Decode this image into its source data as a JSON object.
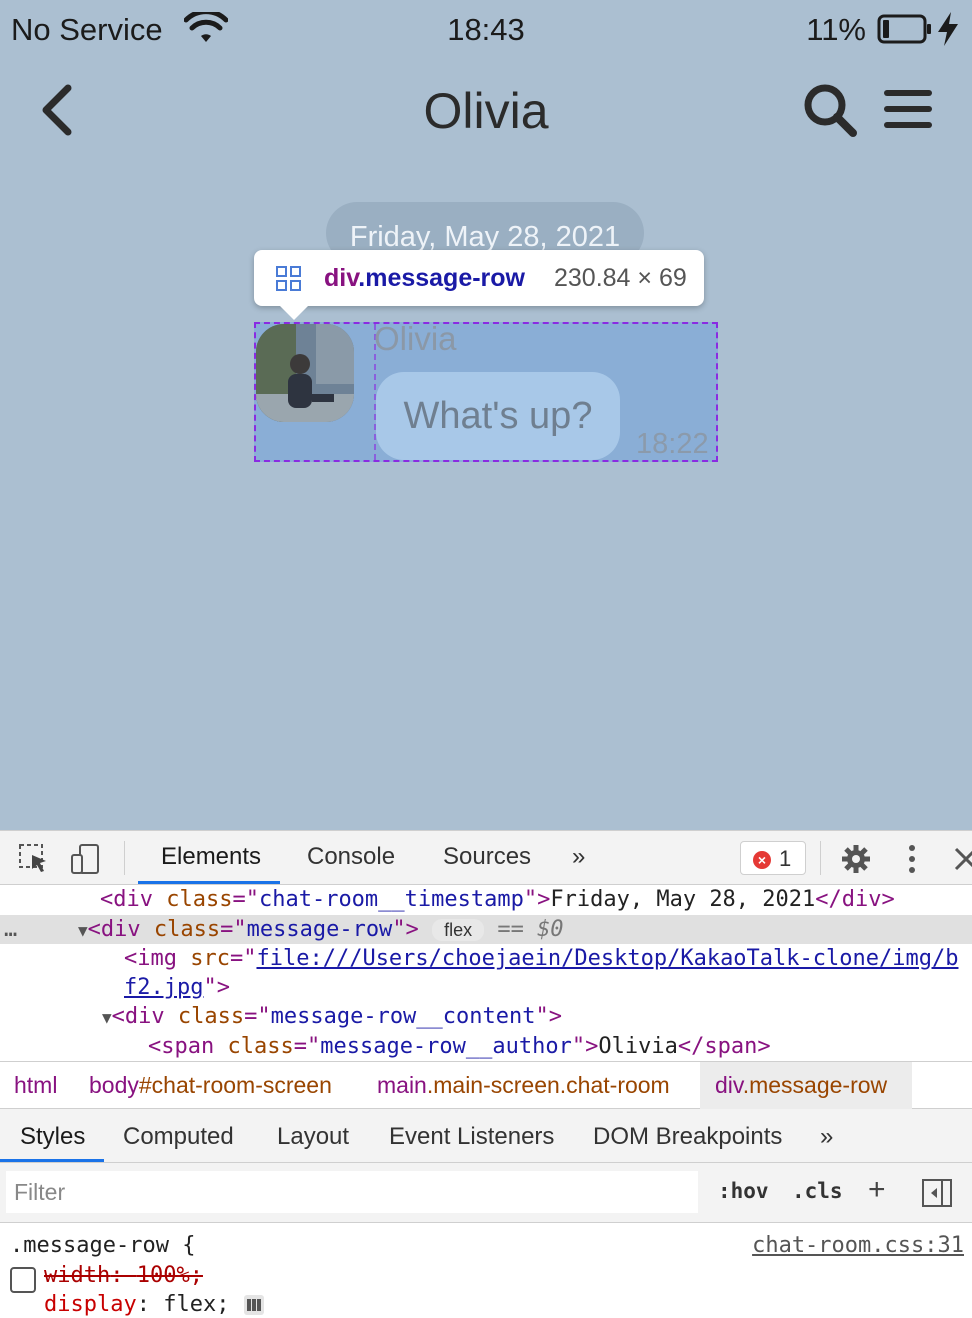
{
  "status_bar": {
    "carrier": "No Service",
    "time": "18:43",
    "battery": "11%"
  },
  "header": {
    "title": "Olivia"
  },
  "chat": {
    "date": "Friday, May 28, 2021",
    "author": "Olivia",
    "message": "What's up?",
    "time": "18:22"
  },
  "inspect_tooltip": {
    "tag": "div",
    "class_name": ".message-row",
    "dimensions": "230.84 × 69"
  },
  "devtools": {
    "tabs": [
      "Elements",
      "Console",
      "Sources",
      "»"
    ],
    "error_count": "1",
    "dom": {
      "line1": {
        "tag_open": "<div ",
        "attr": "class",
        "eq": "=\"",
        "val": "chat-room__timestamp",
        "close": "\">",
        "text": "Friday, May 28, 2021",
        "tag_close": "</div>"
      },
      "line2": {
        "ellipsis": "…",
        "tag_open": "<div ",
        "attr": "class",
        "eq": "=\"",
        "val": "message-row",
        "close": "\">",
        "badge": "flex",
        "ref": "== $0"
      },
      "line3": {
        "tag_open": "<img ",
        "attr": "src",
        "eq": "=\"",
        "val": "file:///Users/choejaein/Desktop/KakaoTalk-clone/img/b"
      },
      "line4": {
        "val": "f2.jpg",
        "close": "\">"
      },
      "line5": {
        "tag_open": "<div ",
        "attr": "class",
        "eq": "=\"",
        "val": "message-row__content",
        "close": "\">"
      },
      "line6": {
        "tag_open": "<span ",
        "attr": "class",
        "eq": "=\"",
        "val": "message-row__author",
        "close": "\">",
        "text": "Olivia",
        "tag_close": "</span>"
      }
    },
    "breadcrumb": [
      {
        "tag": "html",
        "rest": ""
      },
      {
        "tag": "body",
        "rest": "#chat-room-screen"
      },
      {
        "tag": "main",
        "rest": ".main-screen.chat-room"
      },
      {
        "tag": "div",
        "rest": ".message-row"
      }
    ],
    "sub_tabs": [
      "Styles",
      "Computed",
      "Layout",
      "Event Listeners",
      "DOM Breakpoints",
      "»"
    ],
    "filter_placeholder": "Filter",
    "hov": ":hov",
    "cls": ".cls",
    "plus": "+",
    "css_rule": {
      "selector": ".message-row",
      "brace": " {",
      "source": "chat-room.css:31",
      "decl1": {
        "prop": "width",
        "value": "100%;"
      },
      "decl2": {
        "prop": "display",
        "value": "flex;"
      }
    }
  },
  "colors": {
    "chat_background": "#abbfd1",
    "highlight_border": "#8a2be2",
    "devtools_accent": "#1a73e8"
  },
  "icons": [
    "back-chevron-icon",
    "search-icon",
    "menu-icon",
    "wifi-icon",
    "battery-icon",
    "charging-bolt-icon",
    "grid-icon",
    "inspect-cursor-icon",
    "device-toggle-icon",
    "error-icon",
    "gear-icon",
    "kebab-icon",
    "close-icon",
    "flex-editor-icon",
    "sidebar-toggle-icon"
  ]
}
